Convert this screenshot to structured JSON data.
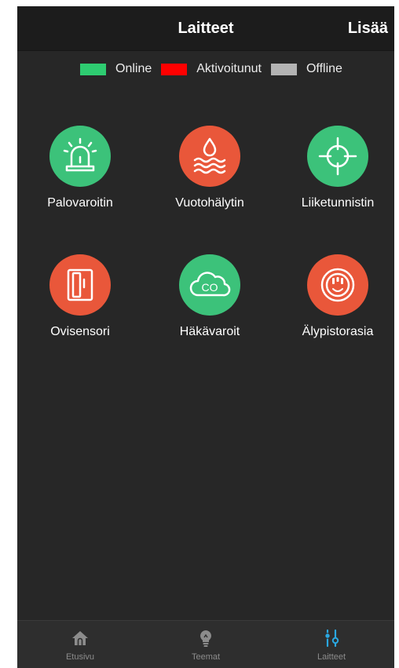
{
  "header": {
    "title": "Laitteet",
    "action_label": "Lisää"
  },
  "legend": {
    "items": [
      {
        "label": "Online",
        "color": "#2ecc71"
      },
      {
        "label": "Aktivoitunut",
        "color": "#ff0000"
      },
      {
        "label": "Offline",
        "color": "#b3b3b3"
      }
    ]
  },
  "devices": [
    {
      "label": "Palovaroitin",
      "icon": "alarm-light-icon",
      "status": "online",
      "color": "#3cc27a"
    },
    {
      "label": "Vuotohälytin",
      "icon": "water-leak-icon",
      "status": "activated",
      "color": "#e9573a"
    },
    {
      "label": "Liiketunnistin",
      "icon": "crosshair-icon",
      "status": "online",
      "color": "#3cc27a"
    },
    {
      "label": "Ovisensori",
      "icon": "door-icon",
      "status": "activated",
      "color": "#e9573a"
    },
    {
      "label": "Häkävaroit",
      "icon": "co-cloud-icon",
      "status": "online",
      "color": "#3cc27a"
    },
    {
      "label": "Älypistorasia",
      "icon": "smart-plug-icon",
      "status": "activated",
      "color": "#e9573a"
    }
  ],
  "tabbar": {
    "tabs": [
      {
        "label": "Etusivu",
        "icon": "home-icon",
        "active": false
      },
      {
        "label": "Teemat",
        "icon": "bulb-icon",
        "active": false
      },
      {
        "label": "Laitteet",
        "icon": "sliders-icon",
        "active": true
      }
    ],
    "active_color": "#2aa7e0",
    "inactive_color": "#8c8c8c"
  }
}
